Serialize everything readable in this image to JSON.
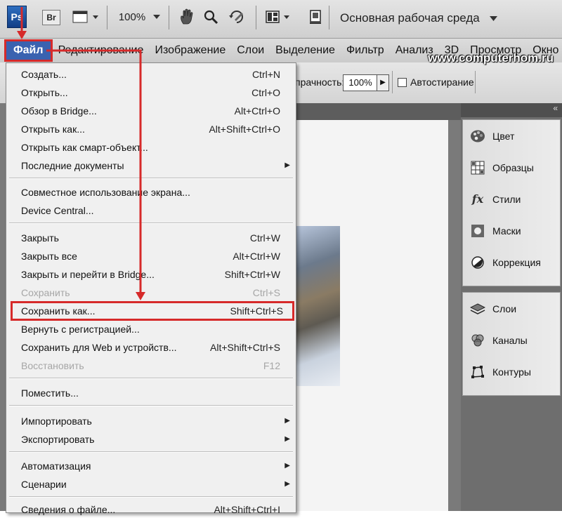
{
  "app": {
    "logo_text": "Ps",
    "bridge_label": "Br",
    "zoom_level": "100%",
    "workspace_name": "Основная рабочая среда",
    "watermark": "www.computerhom.ru"
  },
  "menubar": {
    "items": [
      "Файл",
      "Редактирование",
      "Изображение",
      "Слои",
      "Выделение",
      "Фильтр",
      "Анализ",
      "3D",
      "Просмотр",
      "Окно"
    ]
  },
  "options_bar": {
    "opacity_label": "прачность:",
    "opacity_value": "100%",
    "auto_erase_label": "Автостирание"
  },
  "file_menu": {
    "items": [
      {
        "label": "Создать...",
        "shortcut": "Ctrl+N"
      },
      {
        "label": "Открыть...",
        "shortcut": "Ctrl+O"
      },
      {
        "label": "Обзор в Bridge...",
        "shortcut": "Alt+Ctrl+O"
      },
      {
        "label": "Открыть как...",
        "shortcut": "Alt+Shift+Ctrl+O"
      },
      {
        "label": "Открыть как смарт-объект...",
        "shortcut": ""
      },
      {
        "label": "Последние документы",
        "shortcut": "",
        "submenu": true
      },
      {
        "label": "Совместное использование экрана...",
        "shortcut": ""
      },
      {
        "label": "Device Central...",
        "shortcut": ""
      },
      {
        "label": "Закрыть",
        "shortcut": "Ctrl+W"
      },
      {
        "label": "Закрыть все",
        "shortcut": "Alt+Ctrl+W"
      },
      {
        "label": "Закрыть и перейти в Bridge...",
        "shortcut": "Shift+Ctrl+W"
      },
      {
        "label": "Сохранить",
        "shortcut": "Ctrl+S",
        "disabled": true
      },
      {
        "label": "Сохранить как...",
        "shortcut": "Shift+Ctrl+S",
        "highlighted": true
      },
      {
        "label": "Вернуть с регистрацией...",
        "shortcut": ""
      },
      {
        "label": "Сохранить для Web и устройств...",
        "shortcut": "Alt+Shift+Ctrl+S"
      },
      {
        "label": "Восстановить",
        "shortcut": "F12",
        "disabled": true
      },
      {
        "label": "Поместить...",
        "shortcut": ""
      },
      {
        "label": "Импортировать",
        "shortcut": "",
        "submenu": true
      },
      {
        "label": "Экспортировать",
        "shortcut": "",
        "submenu": true
      },
      {
        "label": "Автоматизация",
        "shortcut": "",
        "submenu": true
      },
      {
        "label": "Сценарии",
        "shortcut": "",
        "submenu": true
      },
      {
        "label": "Сведения о файле...",
        "shortcut": "Alt+Shift+Ctrl+I"
      }
    ]
  },
  "panels": {
    "group1": [
      {
        "label": "Цвет",
        "icon": "color-palette-icon"
      },
      {
        "label": "Образцы",
        "icon": "swatches-grid-icon"
      },
      {
        "label": "Стили",
        "icon": "styles-fx-icon"
      },
      {
        "label": "Маски",
        "icon": "masks-icon"
      },
      {
        "label": "Коррекция",
        "icon": "adjustments-icon"
      }
    ],
    "group2": [
      {
        "label": "Слои",
        "icon": "layers-icon"
      },
      {
        "label": "Каналы",
        "icon": "channels-icon"
      },
      {
        "label": "Контуры",
        "icon": "paths-icon"
      }
    ]
  },
  "colors": {
    "highlight_red": "#d62a2a",
    "active_menu_blue": "#3a62b0"
  }
}
